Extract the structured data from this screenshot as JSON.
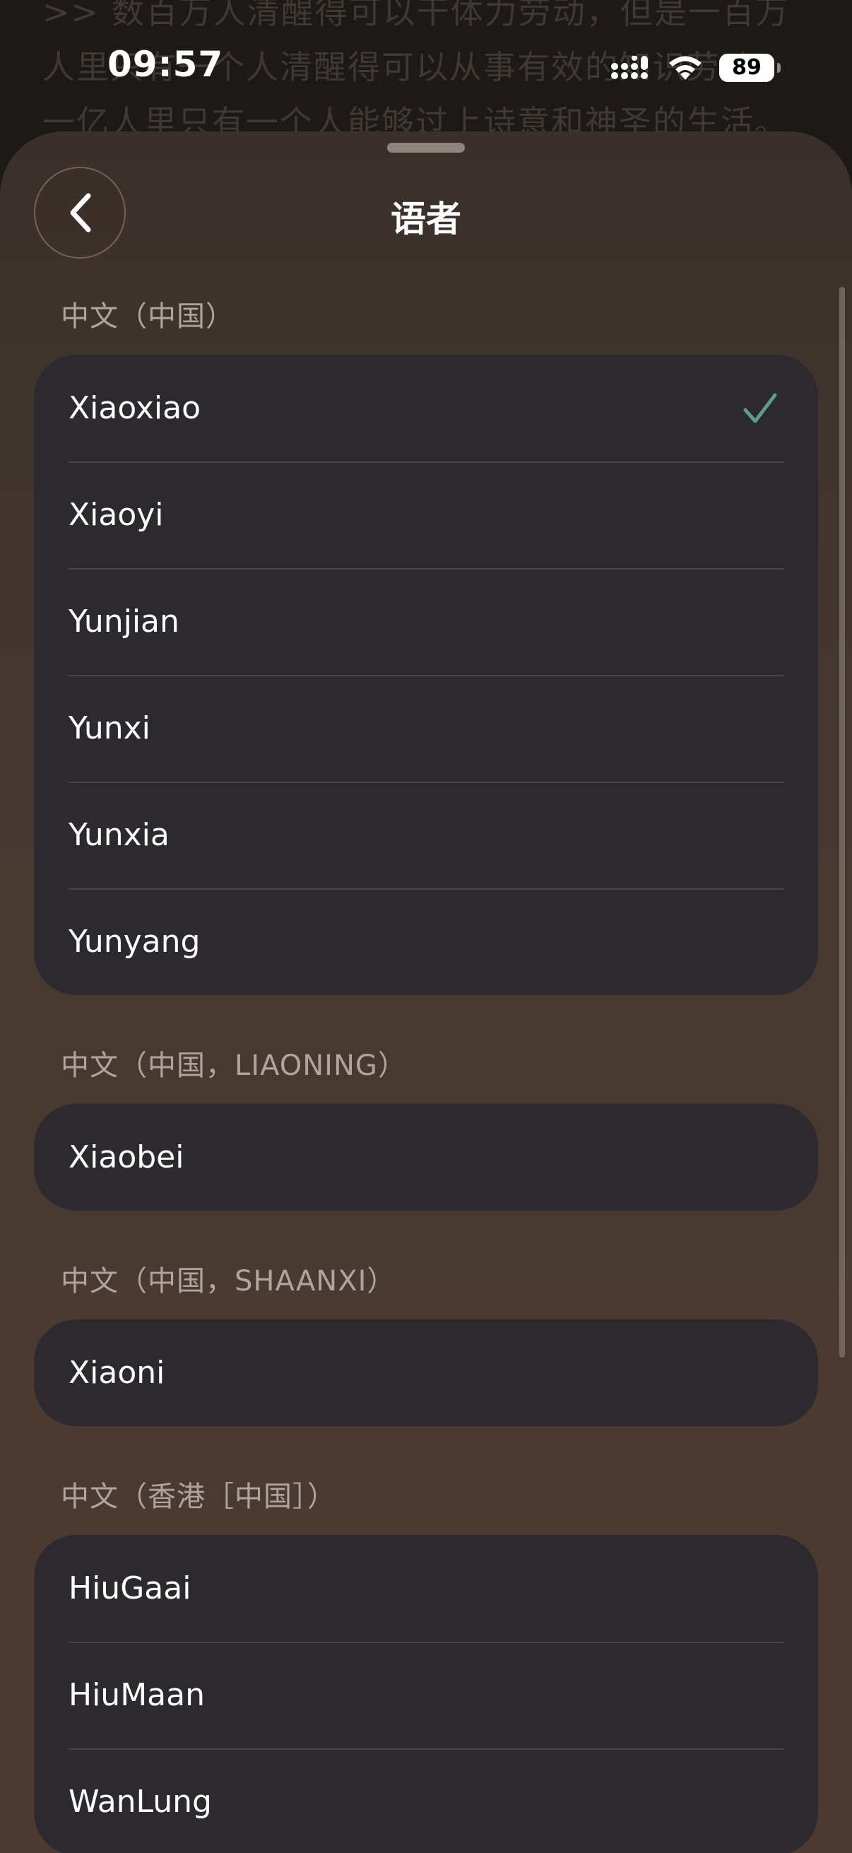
{
  "background": {
    "lines": [
      ">> 数百万人清醒得可以干体力劳动，但是一百万",
      "人里只有一个人清醒得可以从事有效的知识劳动，",
      "一亿人里只有一个人能够过上诗意和神圣的生活。"
    ]
  },
  "status_bar": {
    "time": "09:57",
    "battery": "89",
    "icons": [
      "signal-icon",
      "wifi-icon",
      "battery-icon"
    ]
  },
  "sheet": {
    "title": "语者",
    "back_icon": "chevron-left-icon"
  },
  "sections": [
    {
      "header": "中文（中国）",
      "items": [
        {
          "label": "Xiaoxiao",
          "selected": true
        },
        {
          "label": "Xiaoyi",
          "selected": false
        },
        {
          "label": "Yunjian",
          "selected": false
        },
        {
          "label": "Yunxi",
          "selected": false
        },
        {
          "label": "Yunxia",
          "selected": false
        },
        {
          "label": "Yunyang",
          "selected": false
        }
      ]
    },
    {
      "header": "中文（中国，LIAONING）",
      "items": [
        {
          "label": "Xiaobei",
          "selected": false
        }
      ]
    },
    {
      "header": "中文（中国，SHAANXI）",
      "items": [
        {
          "label": "Xiaoni",
          "selected": false
        }
      ]
    },
    {
      "header": "中文（香港［中国］）",
      "items": [
        {
          "label": "HiuGaai",
          "selected": false
        },
        {
          "label": "HiuMaan",
          "selected": false
        },
        {
          "label": "WanLung",
          "selected": false
        }
      ]
    }
  ],
  "colors": {
    "accent_check": "#5f9c8c",
    "card_bg": "#2c2a2f",
    "sheet_bg": "#463830"
  }
}
